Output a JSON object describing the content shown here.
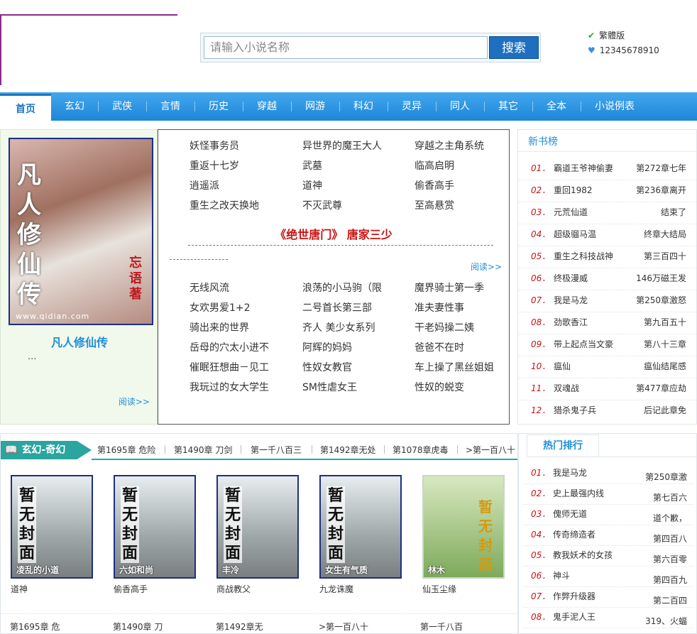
{
  "header": {
    "search_placeholder": "请输入小说名称",
    "search_button": "搜索",
    "traditional_link": "繁體版",
    "phone": "12345678910"
  },
  "nav": [
    "首页",
    "玄幻",
    "武侠",
    "言情",
    "历史",
    "穿越",
    "网游",
    "科幻",
    "灵异",
    "同人",
    "其它",
    "全本",
    "小说例表"
  ],
  "featured": {
    "cover_title": "凡人修仙传",
    "cover_author": "忘语著",
    "cover_url": "www.qidian.com",
    "name": "凡人修仙传",
    "desc": "...",
    "more": "阅读>>"
  },
  "middle": {
    "top_links": [
      "妖怪事务员",
      "异世界的魔王大人",
      "穿越之主角系统",
      "重返十七岁",
      "武墓",
      "临高启明",
      "逍遥派",
      "道神",
      "偷香高手",
      "重生之改天换地",
      "不灭武尊",
      "至高悬赏"
    ],
    "headline": "《绝世唐门》 唐家三少",
    "more": "阅读>>",
    "bottom_links": [
      "无线风流",
      "浪荡的小马驹（限",
      "魔界骑士第一季",
      "女欢男爱1+2",
      "二号首长第三部",
      "准夫妻性事",
      "骑出来的世界",
      "齐人 美少女系列",
      "干老妈操二姨",
      "岳母的穴太小进不",
      "阿辉的妈妈",
      "爸爸不在时",
      "催眠狂想曲－见工",
      "性奴女教官",
      "车上操了黑丝姐姐",
      "我玩过的女大学生",
      "SM性虐女王",
      "性奴的蜕变"
    ]
  },
  "new_books": {
    "title": "新书榜",
    "rows": [
      {
        "num": "01．",
        "name": "霸道王爷神偷妻",
        "chapter": "第272章七年"
      },
      {
        "num": "02．",
        "name": "重回1982",
        "chapter": "第236章离开"
      },
      {
        "num": "03．",
        "name": "元荒仙道",
        "chapter": "结束了"
      },
      {
        "num": "04．",
        "name": "超级骝马温",
        "chapter": "终章大结局"
      },
      {
        "num": "05．",
        "name": "重生之科技战神",
        "chapter": "第三百四十"
      },
      {
        "num": "06．",
        "name": "终极漫威",
        "chapter": "146万磁王发"
      },
      {
        "num": "07．",
        "name": "我是马龙",
        "chapter": "第250章激怒"
      },
      {
        "num": "08．",
        "name": "劲歌香江",
        "chapter": "第九百五十"
      },
      {
        "num": "09．",
        "name": "带上起点当文豪",
        "chapter": "第八十三章"
      },
      {
        "num": "10．",
        "name": "瘟仙",
        "chapter": "瘟仙结尾感"
      },
      {
        "num": "11．",
        "name": "双魂战",
        "chapter": "第477章应劫"
      },
      {
        "num": "12．",
        "name": "猎杀鬼子兵",
        "chapter": "后记此章免"
      }
    ]
  },
  "category": {
    "tag": "玄幻-奇幻",
    "chapters": [
      "第1695章 危险",
      "第1490章 刀剑",
      "第一千八百三",
      "第1492章无处",
      "第1078章虎毒",
      ">第一百八十"
    ],
    "books": [
      {
        "cover_text": "暂无封面",
        "caption": "凌乱的小道",
        "name": "道神"
      },
      {
        "cover_text": "暂无封面",
        "caption": "六如和尚",
        "name": "偷香高手"
      },
      {
        "cover_text": "暂无封面",
        "caption": "丰冷",
        "name": "商战教父"
      },
      {
        "cover_text": "暂无封面",
        "caption": "女生有气质",
        "name": "九龙诛魔"
      },
      {
        "cover_text": "暂无封面",
        "caption": "林木",
        "name": "仙玉尘缘"
      }
    ],
    "footer": [
      "第1695章 危",
      "第1490章 刀",
      "第1492章无",
      ">第一百八十",
      "第一千八百"
    ]
  },
  "hot": {
    "title": "热门排行",
    "rows": [
      {
        "num": "01．",
        "name": "我是马龙",
        "chapter": "第250章激"
      },
      {
        "num": "02．",
        "name": "史上最强内线",
        "chapter": "第七百六"
      },
      {
        "num": "03．",
        "name": "傀师无道",
        "chapter": "道个歉，"
      },
      {
        "num": "04．",
        "name": "传奇缔造者",
        "chapter": "第四百八"
      },
      {
        "num": "05．",
        "name": "教我妖术的女孩",
        "chapter": "第六百零"
      },
      {
        "num": "06．",
        "name": "神斗",
        "chapter": "第四百九"
      },
      {
        "num": "07．",
        "name": "作弊升级器",
        "chapter": "第二百四"
      },
      {
        "num": "08．",
        "name": "鬼手泥人王",
        "chapter": "319、火蝠"
      }
    ]
  }
}
